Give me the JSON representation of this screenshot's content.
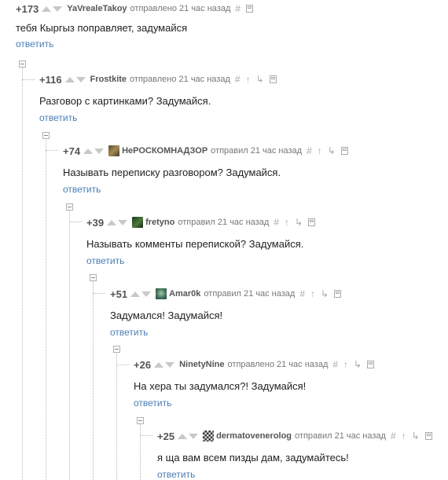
{
  "reply_label": "ответить",
  "comments": [
    {
      "rating": "+173",
      "author": "YaVrealeTakoy",
      "meta": "отправлено 21 час назад",
      "text": "тебя Кыргыз поправляет, задумайся"
    },
    {
      "rating": "+116",
      "author": "Frostkite",
      "meta": "отправлено 21 час назад",
      "text": "Разговор с картинками? Задумайся."
    },
    {
      "rating": "+74",
      "author": "НеРОСКОМНАДЗОР",
      "meta": "отправил 21 час назад",
      "text": "Называть переписку разговором? Задумайся."
    },
    {
      "rating": "+39",
      "author": "fretyno",
      "meta": "отправил 21 час назад",
      "text": "Называть комменты перепиской? Задумайся."
    },
    {
      "rating": "+51",
      "author": "Amar0k",
      "meta": "отправил 21 час назад",
      "text": "Задумался! Задумайся!"
    },
    {
      "rating": "+26",
      "author": "NinetyNine",
      "meta": "отправлено 21 час назад",
      "text": "На хера ты задумался?! Задумайся!"
    },
    {
      "rating": "+25",
      "author": "dermatovenerolog",
      "meta": "отправил 21 час назад",
      "text": "я ща вам всем пизды дам, задумайтесь!"
    }
  ],
  "icons": {
    "link": "#",
    "up": "↑",
    "parent": "↳"
  },
  "colors": {
    "link": "#4a7db3",
    "rating": "#555555",
    "arrow": "#c8c8c8"
  }
}
